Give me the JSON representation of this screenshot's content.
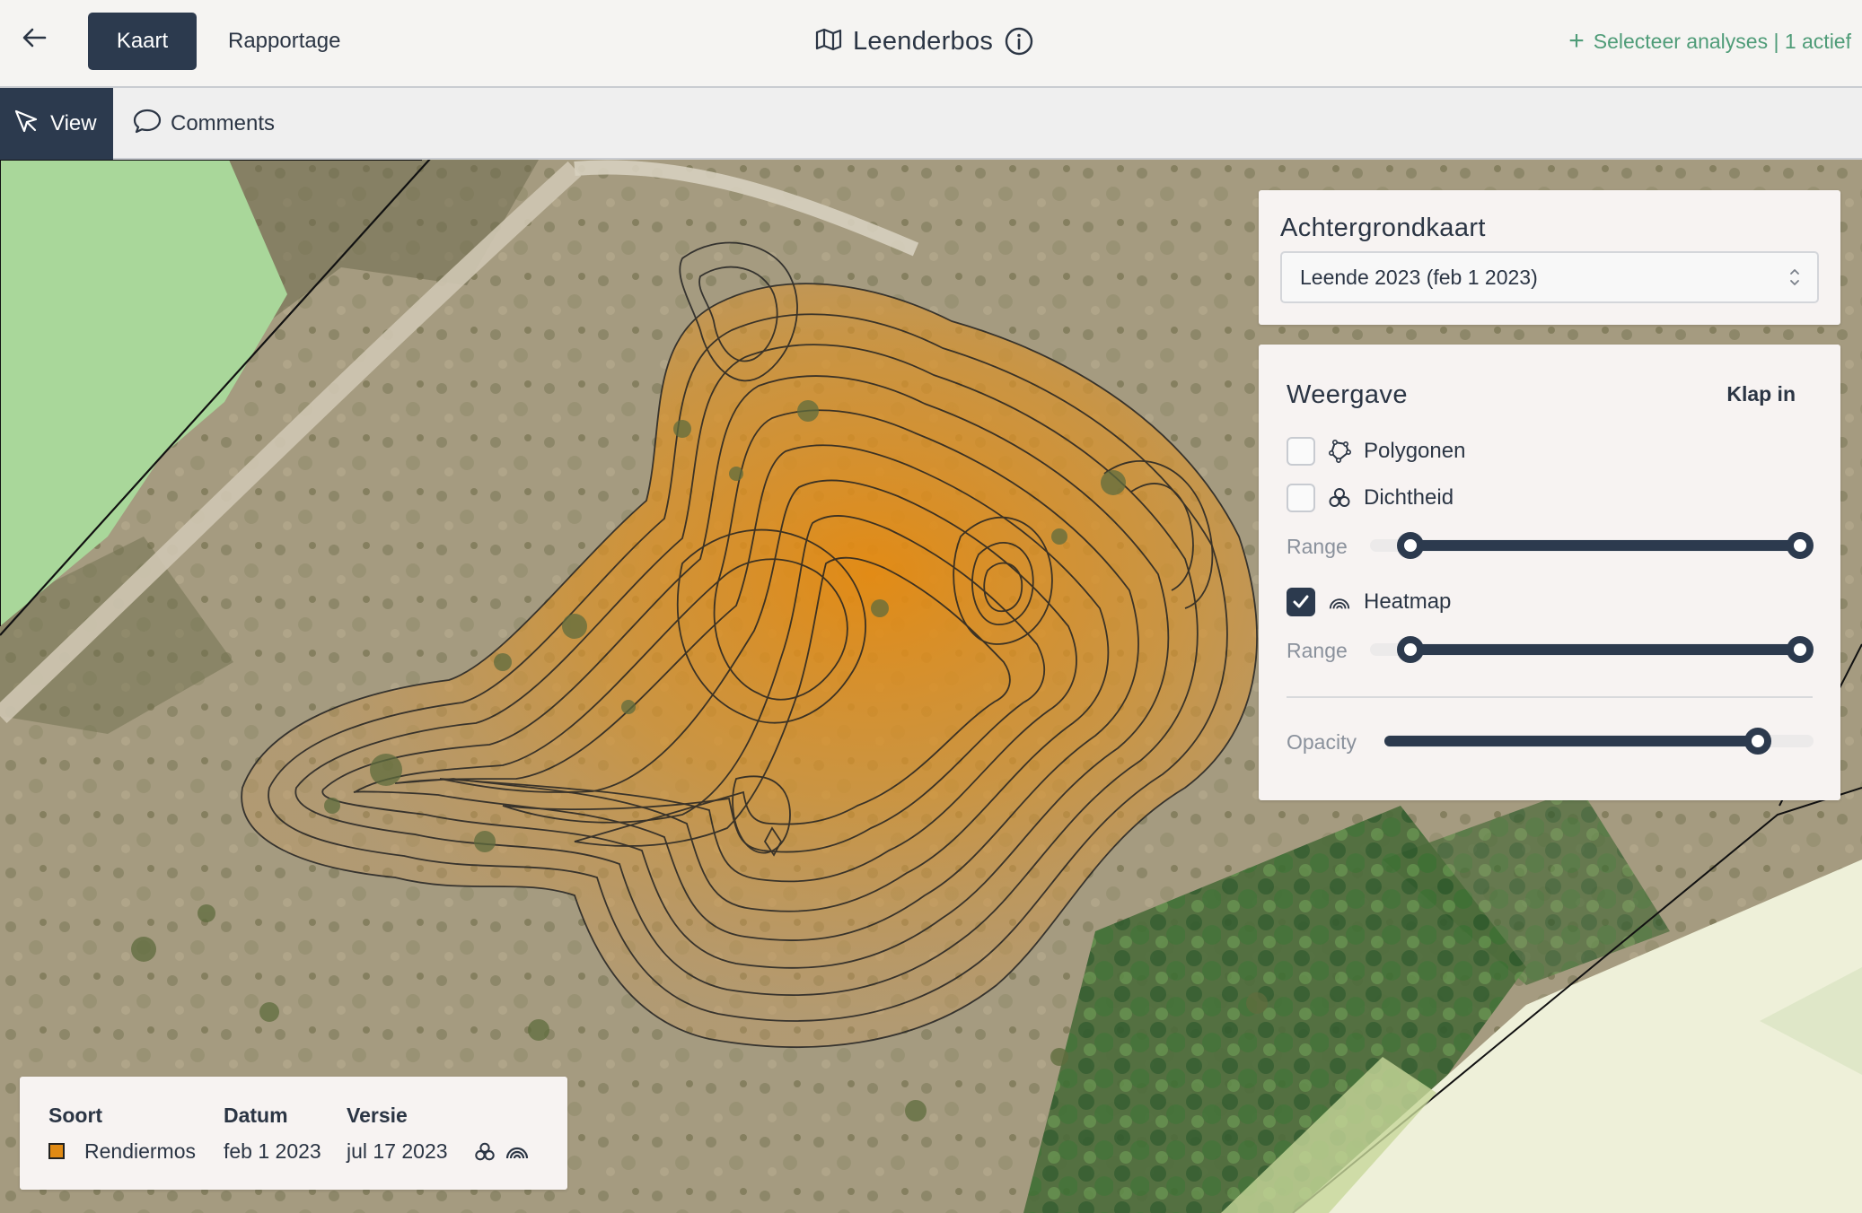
{
  "header": {
    "back_icon": "arrow-left-icon",
    "tab_kaart": "Kaart",
    "tab_rapportage": "Rapportage",
    "map_icon": "map-icon",
    "title": "Leenderbos",
    "info_icon": "info-icon",
    "select_analyses": "Selecteer analyses | 1 actief",
    "accent_color": "#4f9c78"
  },
  "toolbar": {
    "view_label": "View",
    "comments_label": "Comments"
  },
  "background_panel": {
    "title": "Achtergrondkaart",
    "selected": "Leende 2023 (feb 1 2023)"
  },
  "view_panel": {
    "title": "Weergave",
    "collapse_label": "Klap in",
    "options": [
      {
        "label": "Polygonen",
        "checked": false,
        "icon": "polygon-icon"
      },
      {
        "label": "Dichtheid",
        "checked": false,
        "icon": "density-icon"
      },
      {
        "label": "Heatmap",
        "checked": true,
        "icon": "heatmap-icon"
      }
    ],
    "range_label": "Range",
    "dichtheid_range": [
      0,
      1
    ],
    "heatmap_range": [
      0,
      1
    ],
    "opacity_label": "Opacity",
    "opacity": 0.87
  },
  "legend": {
    "headers": {
      "soort": "Soort",
      "datum": "Datum",
      "versie": "Versie"
    },
    "row": {
      "soort": "Rendiermos",
      "datum": "feb 1 2023",
      "versie": "jul 17 2023"
    },
    "swatch_color": "#e08a14"
  },
  "colors": {
    "primary": "#2c3a4e",
    "heat": "#e08a14"
  }
}
